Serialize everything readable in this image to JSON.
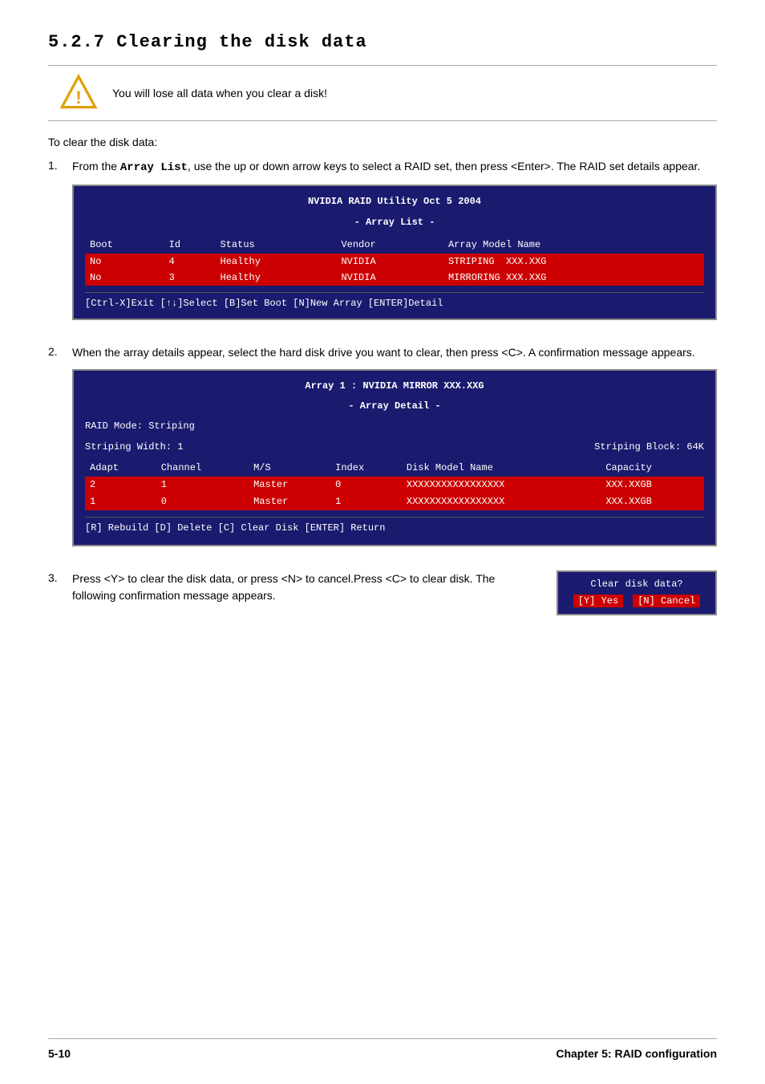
{
  "page": {
    "title": "5.2.7   Clearing the disk data",
    "warning": "You will lose all data when you clear a disk!",
    "intro": "To clear the disk data:",
    "footer_left": "5-10",
    "footer_right": "Chapter 5: RAID configuration"
  },
  "steps": [
    {
      "number": "1.",
      "text": "From the Array List, use the up or down arrow keys to select a RAID set, then press <Enter>. The RAID set details appear.",
      "bold_part": "Array List"
    },
    {
      "number": "2.",
      "text": "When the array details appear, select the hard disk drive you want to clear, then press <C>. A confirmation message appears."
    },
    {
      "number": "3.",
      "text": "Press <Y> to clear the disk data, or press <N> to cancel.Press <C> to clear disk. The following confirmation message appears."
    }
  ],
  "array_list_console": {
    "title1": "NVIDIA RAID Utility  Oct 5 2004",
    "title2": "- Array List -",
    "headers": [
      "Boot",
      "Id",
      "Status",
      "Vendor",
      "Array Model Name"
    ],
    "rows": [
      {
        "boot": "No",
        "id": "4",
        "status": "Healthy",
        "vendor": "NVIDIA",
        "model": "STRIPING  XXX.XXG",
        "highlight": true
      },
      {
        "boot": "No",
        "id": "3",
        "status": "Healthy",
        "vendor": "NVIDIA",
        "model": "MIRRORING XXX.XXG",
        "highlight": true
      }
    ],
    "footer": "[Ctrl-X]Exit   [↑↓]Select   [B]Set Boot   [N]New Array   [ENTER]Detail"
  },
  "array_detail_console": {
    "title1": "Array 1 : NVIDIA MIRROR  XXX.XXG",
    "title2": "- Array Detail -",
    "raid_mode": "RAID Mode: Striping",
    "striping_width": "Striping Width: 1",
    "striping_block": "Striping Block: 64K",
    "headers": [
      "Adapt",
      "Channel",
      "M/S",
      "Index",
      "Disk Model Name",
      "Capacity"
    ],
    "rows": [
      {
        "adapt": "2",
        "channel": "1",
        "ms": "Master",
        "index": "0",
        "model": "XXXXXXXXXXXXXXXXX",
        "capacity": "XXX.XXGB",
        "highlight": true
      },
      {
        "adapt": "1",
        "channel": "0",
        "ms": "Master",
        "index": "1",
        "model": "XXXXXXXXXXXXXXXXX",
        "capacity": "XXX.XXGB",
        "highlight": true
      }
    ],
    "footer": "[R] Rebuild   [D] Delete   [C] Clear Disk   [ENTER] Return"
  },
  "confirm_dialog": {
    "title": "Clear disk data?",
    "yes_label": "[Y] Yes",
    "cancel_label": "[N] Cancel"
  }
}
